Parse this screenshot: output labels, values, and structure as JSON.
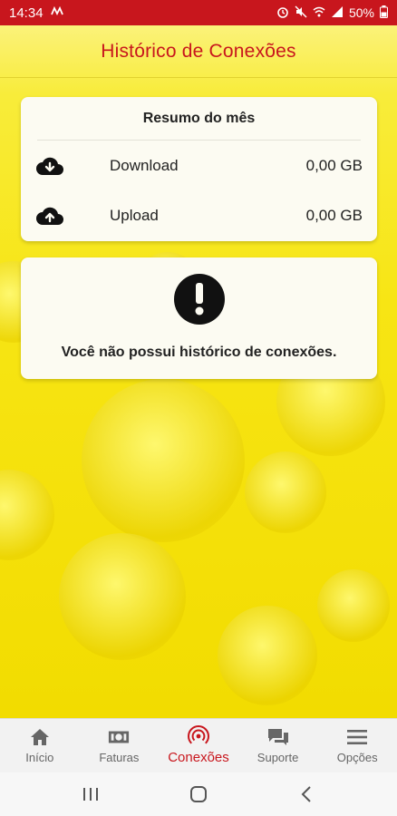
{
  "status_bar": {
    "time": "14:34",
    "battery": "50%"
  },
  "header": {
    "title": "Histórico de Conexões"
  },
  "summary": {
    "title": "Resumo do mês",
    "rows": [
      {
        "label": "Download",
        "value": "0,00 GB",
        "icon": "cloud-download-icon"
      },
      {
        "label": "Upload",
        "value": "0,00 GB",
        "icon": "cloud-upload-icon"
      }
    ]
  },
  "empty_state": {
    "icon": "exclamation-icon",
    "message": "Você não possui histórico de conexões."
  },
  "bottom_nav": {
    "items": [
      {
        "label": "Início",
        "icon": "home-icon"
      },
      {
        "label": "Faturas",
        "icon": "money-icon"
      },
      {
        "label": "Conexões",
        "icon": "connections-icon",
        "active": true
      },
      {
        "label": "Suporte",
        "icon": "chat-icon"
      },
      {
        "label": "Opções",
        "icon": "menu-icon"
      }
    ]
  },
  "colors": {
    "brand_red": "#c8161d",
    "yellow": "#f7e600"
  }
}
